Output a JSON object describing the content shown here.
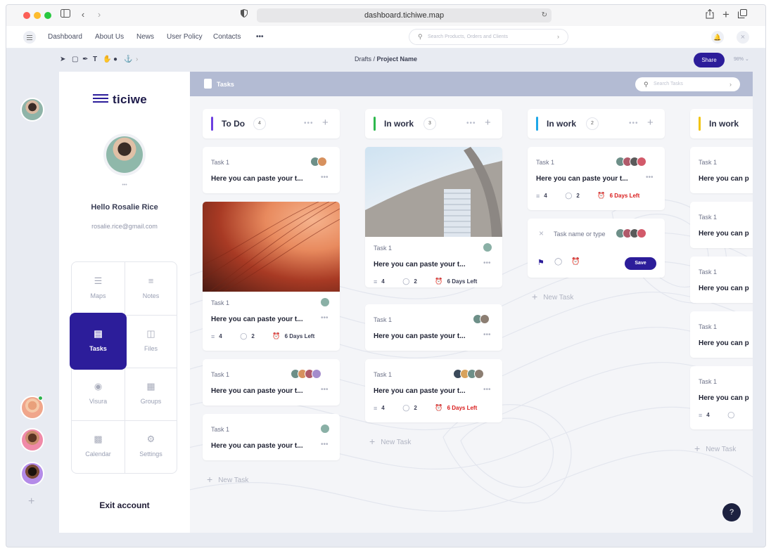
{
  "browser": {
    "url": "dashboard.tichiwe.map"
  },
  "menu": {
    "items": [
      "Dashboard",
      "About Us",
      "News",
      "User Policy",
      "Contacts",
      "•••"
    ],
    "search_placeholder": "Search Products, Orders and Clients"
  },
  "toolbar": {
    "crumb_prefix": "Drafts / ",
    "crumb_page": "Project Name",
    "share": "Share",
    "zoom": "98%"
  },
  "sidebar": {
    "logo": "ticiwe",
    "dots": "•••",
    "greeting": "Hello Rosalie Rice",
    "email": "rosalie.rice@gmail.com",
    "items": [
      {
        "label": "Maps",
        "icon": "layers-icon"
      },
      {
        "label": "Notes",
        "icon": "notes-icon"
      },
      {
        "label": "Tasks",
        "icon": "clipboard-icon"
      },
      {
        "label": "Files",
        "icon": "inbox-icon"
      },
      {
        "label": "Visura",
        "icon": "target-icon"
      },
      {
        "label": "Groups",
        "icon": "grid-icon"
      },
      {
        "label": "Calendar",
        "icon": "calendar-icon"
      },
      {
        "label": "Settings",
        "icon": "gear-icon"
      }
    ],
    "exit": "Exit account"
  },
  "board": {
    "title": "Tasks",
    "search_placeholder": "Search Tasks",
    "new_task": "New Task",
    "columns": [
      {
        "title": "To Do",
        "count": "4",
        "color": "#6c3fe0"
      },
      {
        "title": "In work",
        "count": "3",
        "color": "#2db84d"
      },
      {
        "title": "In work",
        "count": "2",
        "color": "#1ea7e8"
      },
      {
        "title": "In work",
        "count": "",
        "color": "#f2c40c"
      }
    ],
    "cards": {
      "label": "Task 1",
      "title": "Here you can paste your t...",
      "title_short": "Here you can p",
      "subtasks": "4",
      "attachments": "2",
      "due": "6 Days Left"
    },
    "quick_add": {
      "placeholder": "Task name or type",
      "save": "Save"
    }
  },
  "help": "?"
}
